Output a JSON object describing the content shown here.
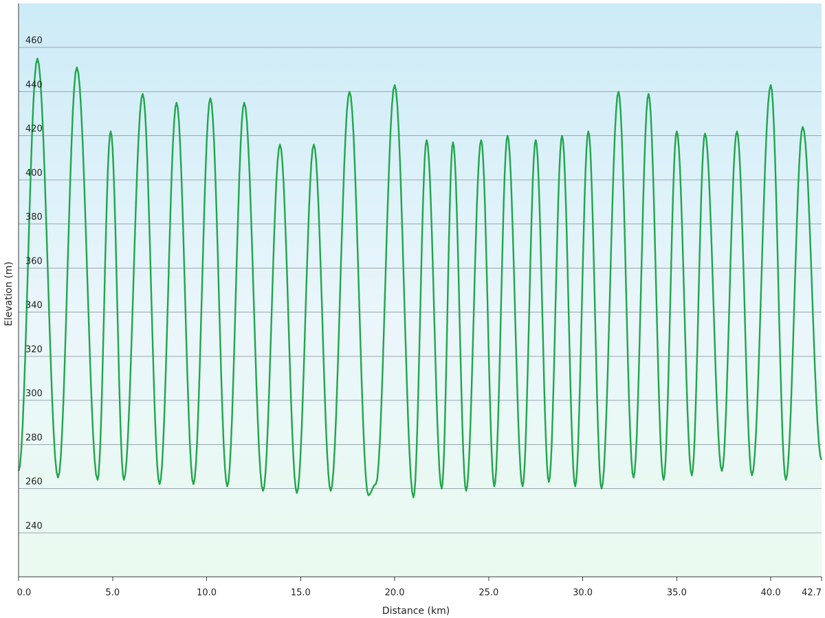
{
  "chart_data": {
    "type": "line",
    "xlabel": "Distance  (km)",
    "ylabel": "Elevation (m)",
    "xlim": [
      0,
      42.7
    ],
    "ylim": [
      220,
      480
    ],
    "x_ticks": [
      "0.0",
      "5.0",
      "10.0",
      "15.0",
      "20.0",
      "25.0",
      "30.0",
      "35.0",
      "40.0",
      "42.7"
    ],
    "x_tick_values": [
      0,
      5,
      10,
      15,
      20,
      25,
      30,
      35,
      40,
      42.7
    ],
    "y_ticks": [
      "240",
      "260",
      "280",
      "300",
      "320",
      "340",
      "360",
      "380",
      "400",
      "420",
      "440",
      "460"
    ],
    "y_tick_values": [
      240,
      260,
      280,
      300,
      320,
      340,
      360,
      380,
      400,
      420,
      440,
      460
    ],
    "grid": "horizontal",
    "legend": "none",
    "series": [
      {
        "x": [
          0.0,
          1.0,
          2.1,
          3.1,
          4.2,
          4.9,
          5.6,
          6.6,
          7.5,
          8.4,
          9.3,
          10.2,
          11.1,
          12.0,
          13.0,
          13.9,
          14.8,
          15.7,
          16.6,
          17.6,
          18.6,
          19.0,
          20.0,
          21.0,
          21.7,
          22.5,
          23.1,
          23.8,
          24.6,
          25.3,
          26.0,
          26.8,
          27.5,
          28.2,
          28.9,
          29.6,
          30.3,
          31.0,
          31.9,
          32.7,
          33.5,
          34.3,
          35.0,
          35.8,
          36.5,
          37.4,
          38.2,
          39.0,
          40.0,
          40.8,
          41.7,
          42.7
        ],
        "y": [
          268,
          455,
          265,
          451,
          264,
          422,
          264,
          439,
          262,
          435,
          262,
          437,
          261,
          435,
          259,
          416,
          258,
          416,
          259,
          440,
          257,
          262,
          443,
          256,
          418,
          260,
          417,
          259,
          418,
          261,
          420,
          261,
          418,
          263,
          420,
          261,
          422,
          260,
          440,
          265,
          439,
          264,
          422,
          266,
          421,
          268,
          422,
          266,
          443,
          264,
          424,
          273
        ]
      }
    ],
    "colors": {
      "line": "#1fa64a",
      "bg_top": "#cdebf7",
      "bg_middle": "#eaf6fb",
      "bg_bottom": "#eafaf0",
      "grid": "#9aa6ad"
    }
  }
}
